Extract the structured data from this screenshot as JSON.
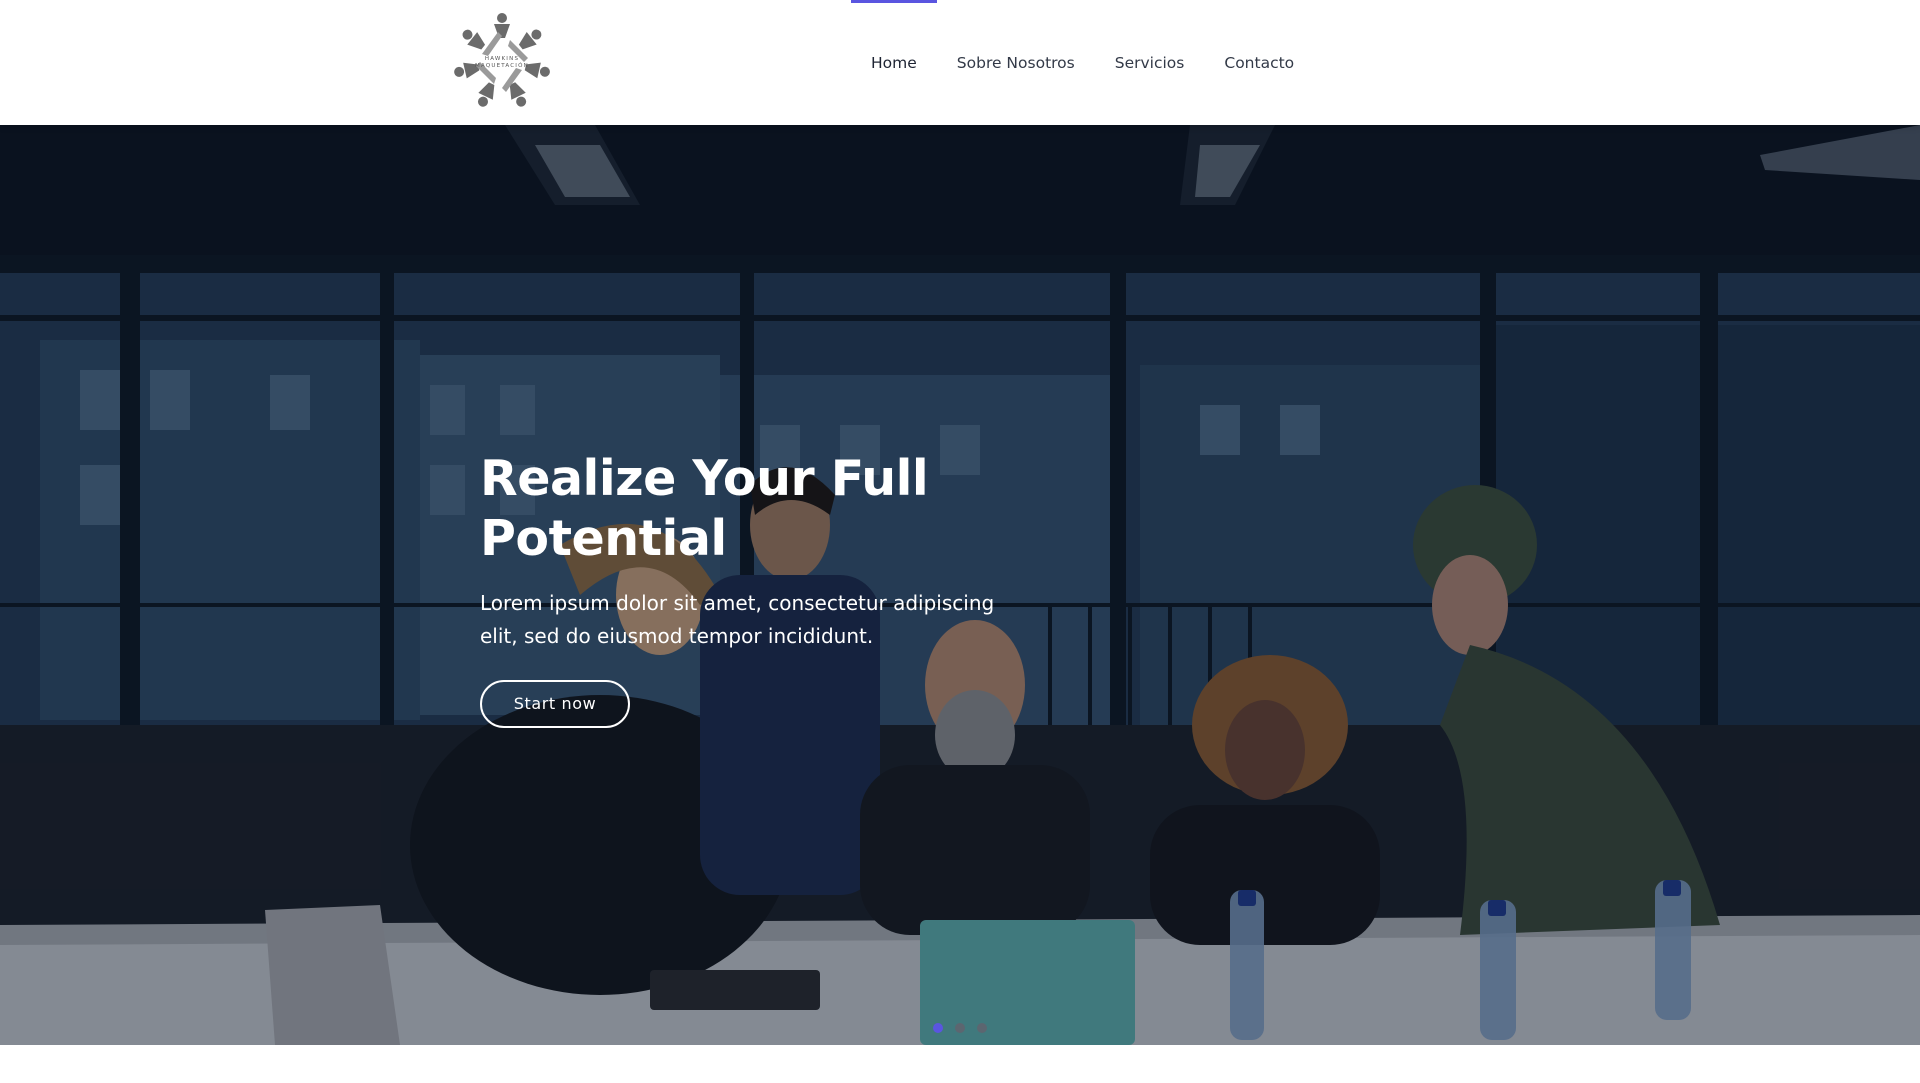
{
  "brand": {
    "logo_text_line1": "HAWKINS",
    "logo_text_line2": "MAQUETACIÓN"
  },
  "nav": {
    "items": [
      {
        "label": "Home",
        "active": true
      },
      {
        "label": "Sobre Nosotros",
        "active": false
      },
      {
        "label": "Servicios",
        "active": false
      },
      {
        "label": "Contacto",
        "active": false
      }
    ]
  },
  "hero": {
    "title_line1": "Realize Your Full",
    "title_line2": "Potential",
    "subtitle_line1": "Lorem ipsum dolor sit amet, consectetur adipiscing",
    "subtitle_line2": "elit, sed do eiusmod tempor incididunt.",
    "cta_label": "Start now"
  },
  "slider": {
    "slide_count": 3,
    "active_slide": 1
  },
  "colors": {
    "accent": "#5a55e0",
    "nav_text": "#333a48",
    "hero_text": "#ffffff"
  },
  "icons": {
    "logo": "people-circle-logo",
    "slide_dot": "dot-indicator"
  }
}
